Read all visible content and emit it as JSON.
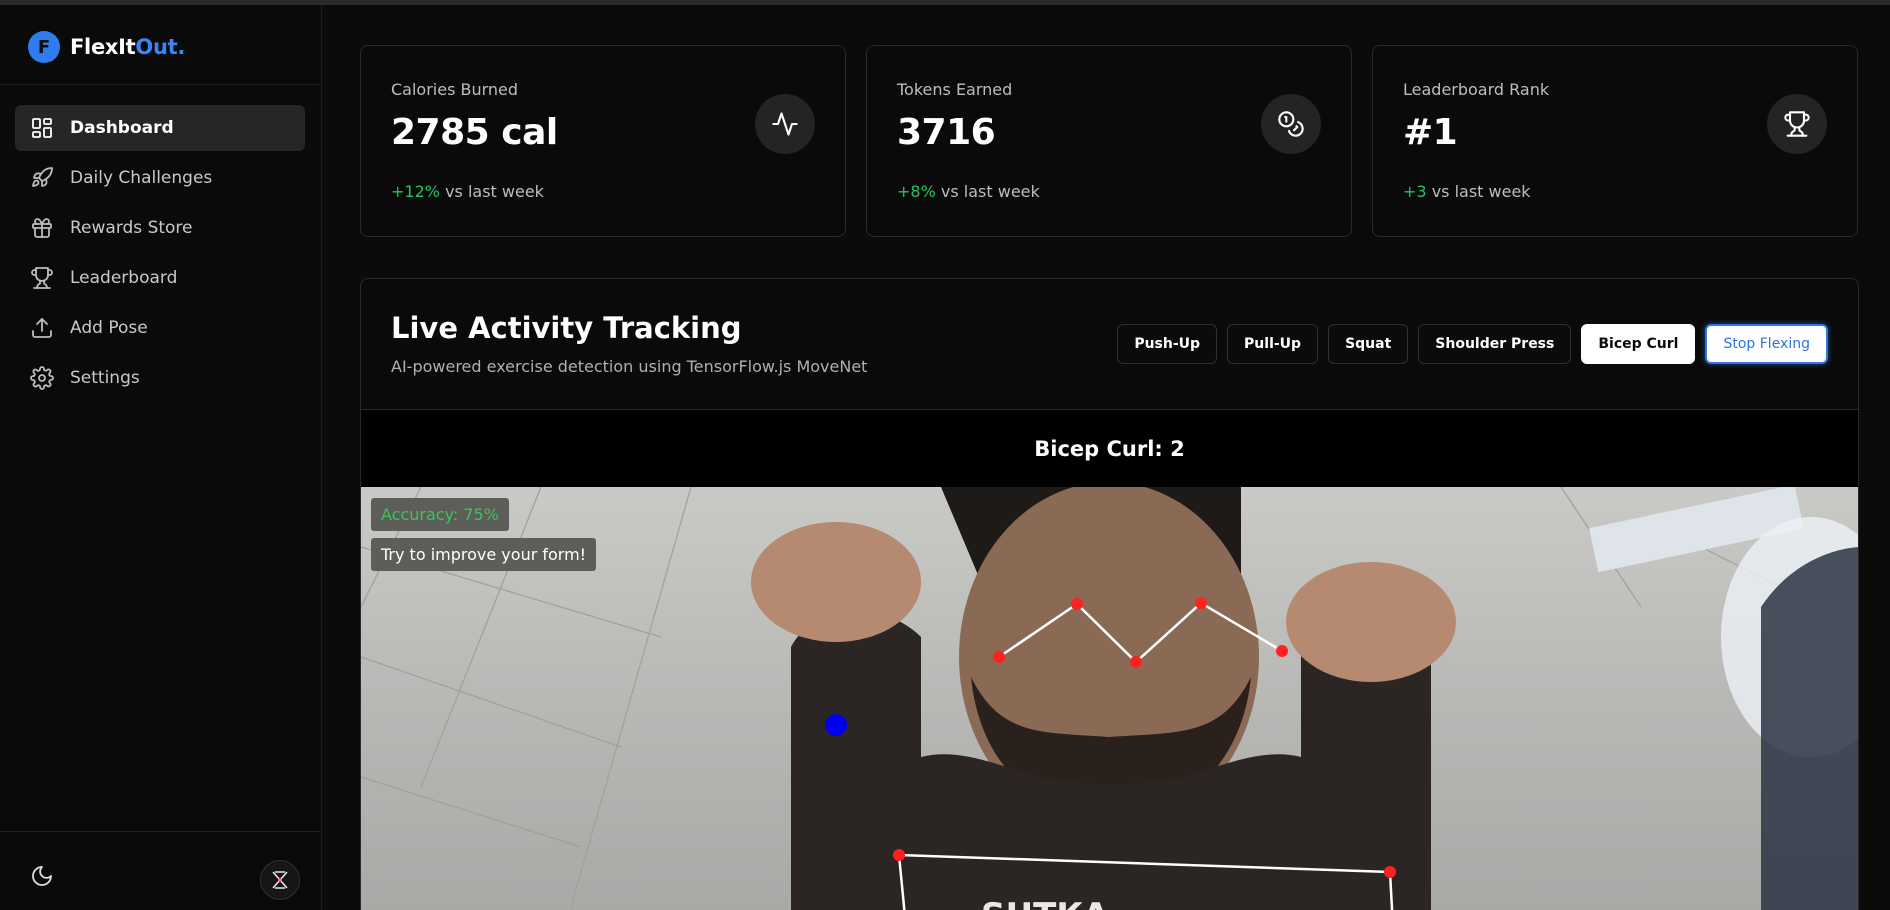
{
  "brand": {
    "name_prefix": "FlexIt",
    "name_accent": "Out",
    "name_dot": ".",
    "logo_letter": "F"
  },
  "sidebar": {
    "items": [
      {
        "label": "Dashboard",
        "icon": "dashboard-grid-icon",
        "active": true
      },
      {
        "label": "Daily Challenges",
        "icon": "rocket-icon",
        "active": false
      },
      {
        "label": "Rewards Store",
        "icon": "gift-icon",
        "active": false
      },
      {
        "label": "Leaderboard",
        "icon": "trophy-icon",
        "active": false
      },
      {
        "label": "Add Pose",
        "icon": "upload-icon",
        "active": false
      },
      {
        "label": "Settings",
        "icon": "gear-icon",
        "active": false
      }
    ],
    "footer": {
      "theme_icon": "moon-icon",
      "avatar_icon": "user-avatar-icon"
    }
  },
  "stats": [
    {
      "label": "Calories Burned",
      "value": "2785 cal",
      "delta": "+12%",
      "suffix": "vs last week",
      "icon": "activity-icon"
    },
    {
      "label": "Tokens Earned",
      "value": "3716",
      "delta": "+8%",
      "suffix": "vs last week",
      "icon": "coins-icon"
    },
    {
      "label": "Leaderboard Rank",
      "value": "#1",
      "delta": "+3",
      "suffix": "vs last week",
      "icon": "trophy-icon"
    }
  ],
  "tracking": {
    "title": "Live Activity Tracking",
    "subtitle": "AI-powered exercise detection using TensorFlow.js MoveNet",
    "exercises": [
      "Push-Up",
      "Pull-Up",
      "Squat",
      "Shoulder Press",
      "Bicep Curl"
    ],
    "selected_exercise": "Bicep Curl",
    "stop_label": "Stop Flexing",
    "counter": "Bicep Curl: 2",
    "accuracy": "Accuracy: 75%",
    "feedback": "Try to improve your form!",
    "colors": {
      "accuracy": "#3fc35a",
      "keypoint": "#ff2020",
      "skeleton": "#ffffff",
      "marker": "#0000ee"
    }
  },
  "colors": {
    "accent": "#3b86f5",
    "positive": "#22c55e",
    "background": "#0b0b0b"
  }
}
